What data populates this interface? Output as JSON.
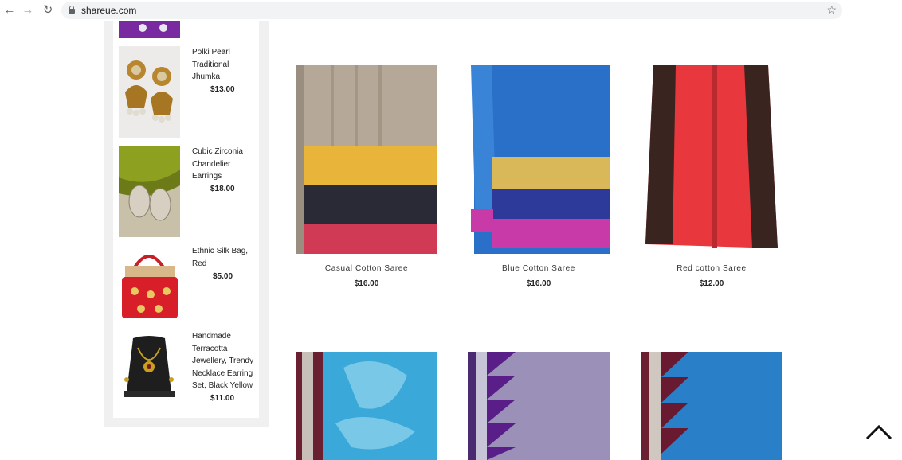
{
  "browser": {
    "url": "shareue.com"
  },
  "sidebar": {
    "items": [
      {
        "name": "Polki Pearl Traditional Jhumka",
        "price": "$13.00"
      },
      {
        "name": "Cubic Zirconia Chandelier Earrings",
        "price": "$18.00"
      },
      {
        "name": "Ethnic Silk Bag, Red",
        "price": "$5.00"
      },
      {
        "name": "Handmade Terracotta Jewellery, Trendy Necklace Earring Set, Black Yellow",
        "price": "$11.00"
      }
    ]
  },
  "products": [
    {
      "name": "Casual Cotton Saree",
      "price": "$16.00"
    },
    {
      "name": "Blue Cotton Saree",
      "price": "$16.00"
    },
    {
      "name": "Red cotton Saree",
      "price": "$12.00"
    }
  ],
  "colors": {
    "sidebar_bg": "#f0f0f0",
    "chrome_bg": "#f1f3f4"
  }
}
